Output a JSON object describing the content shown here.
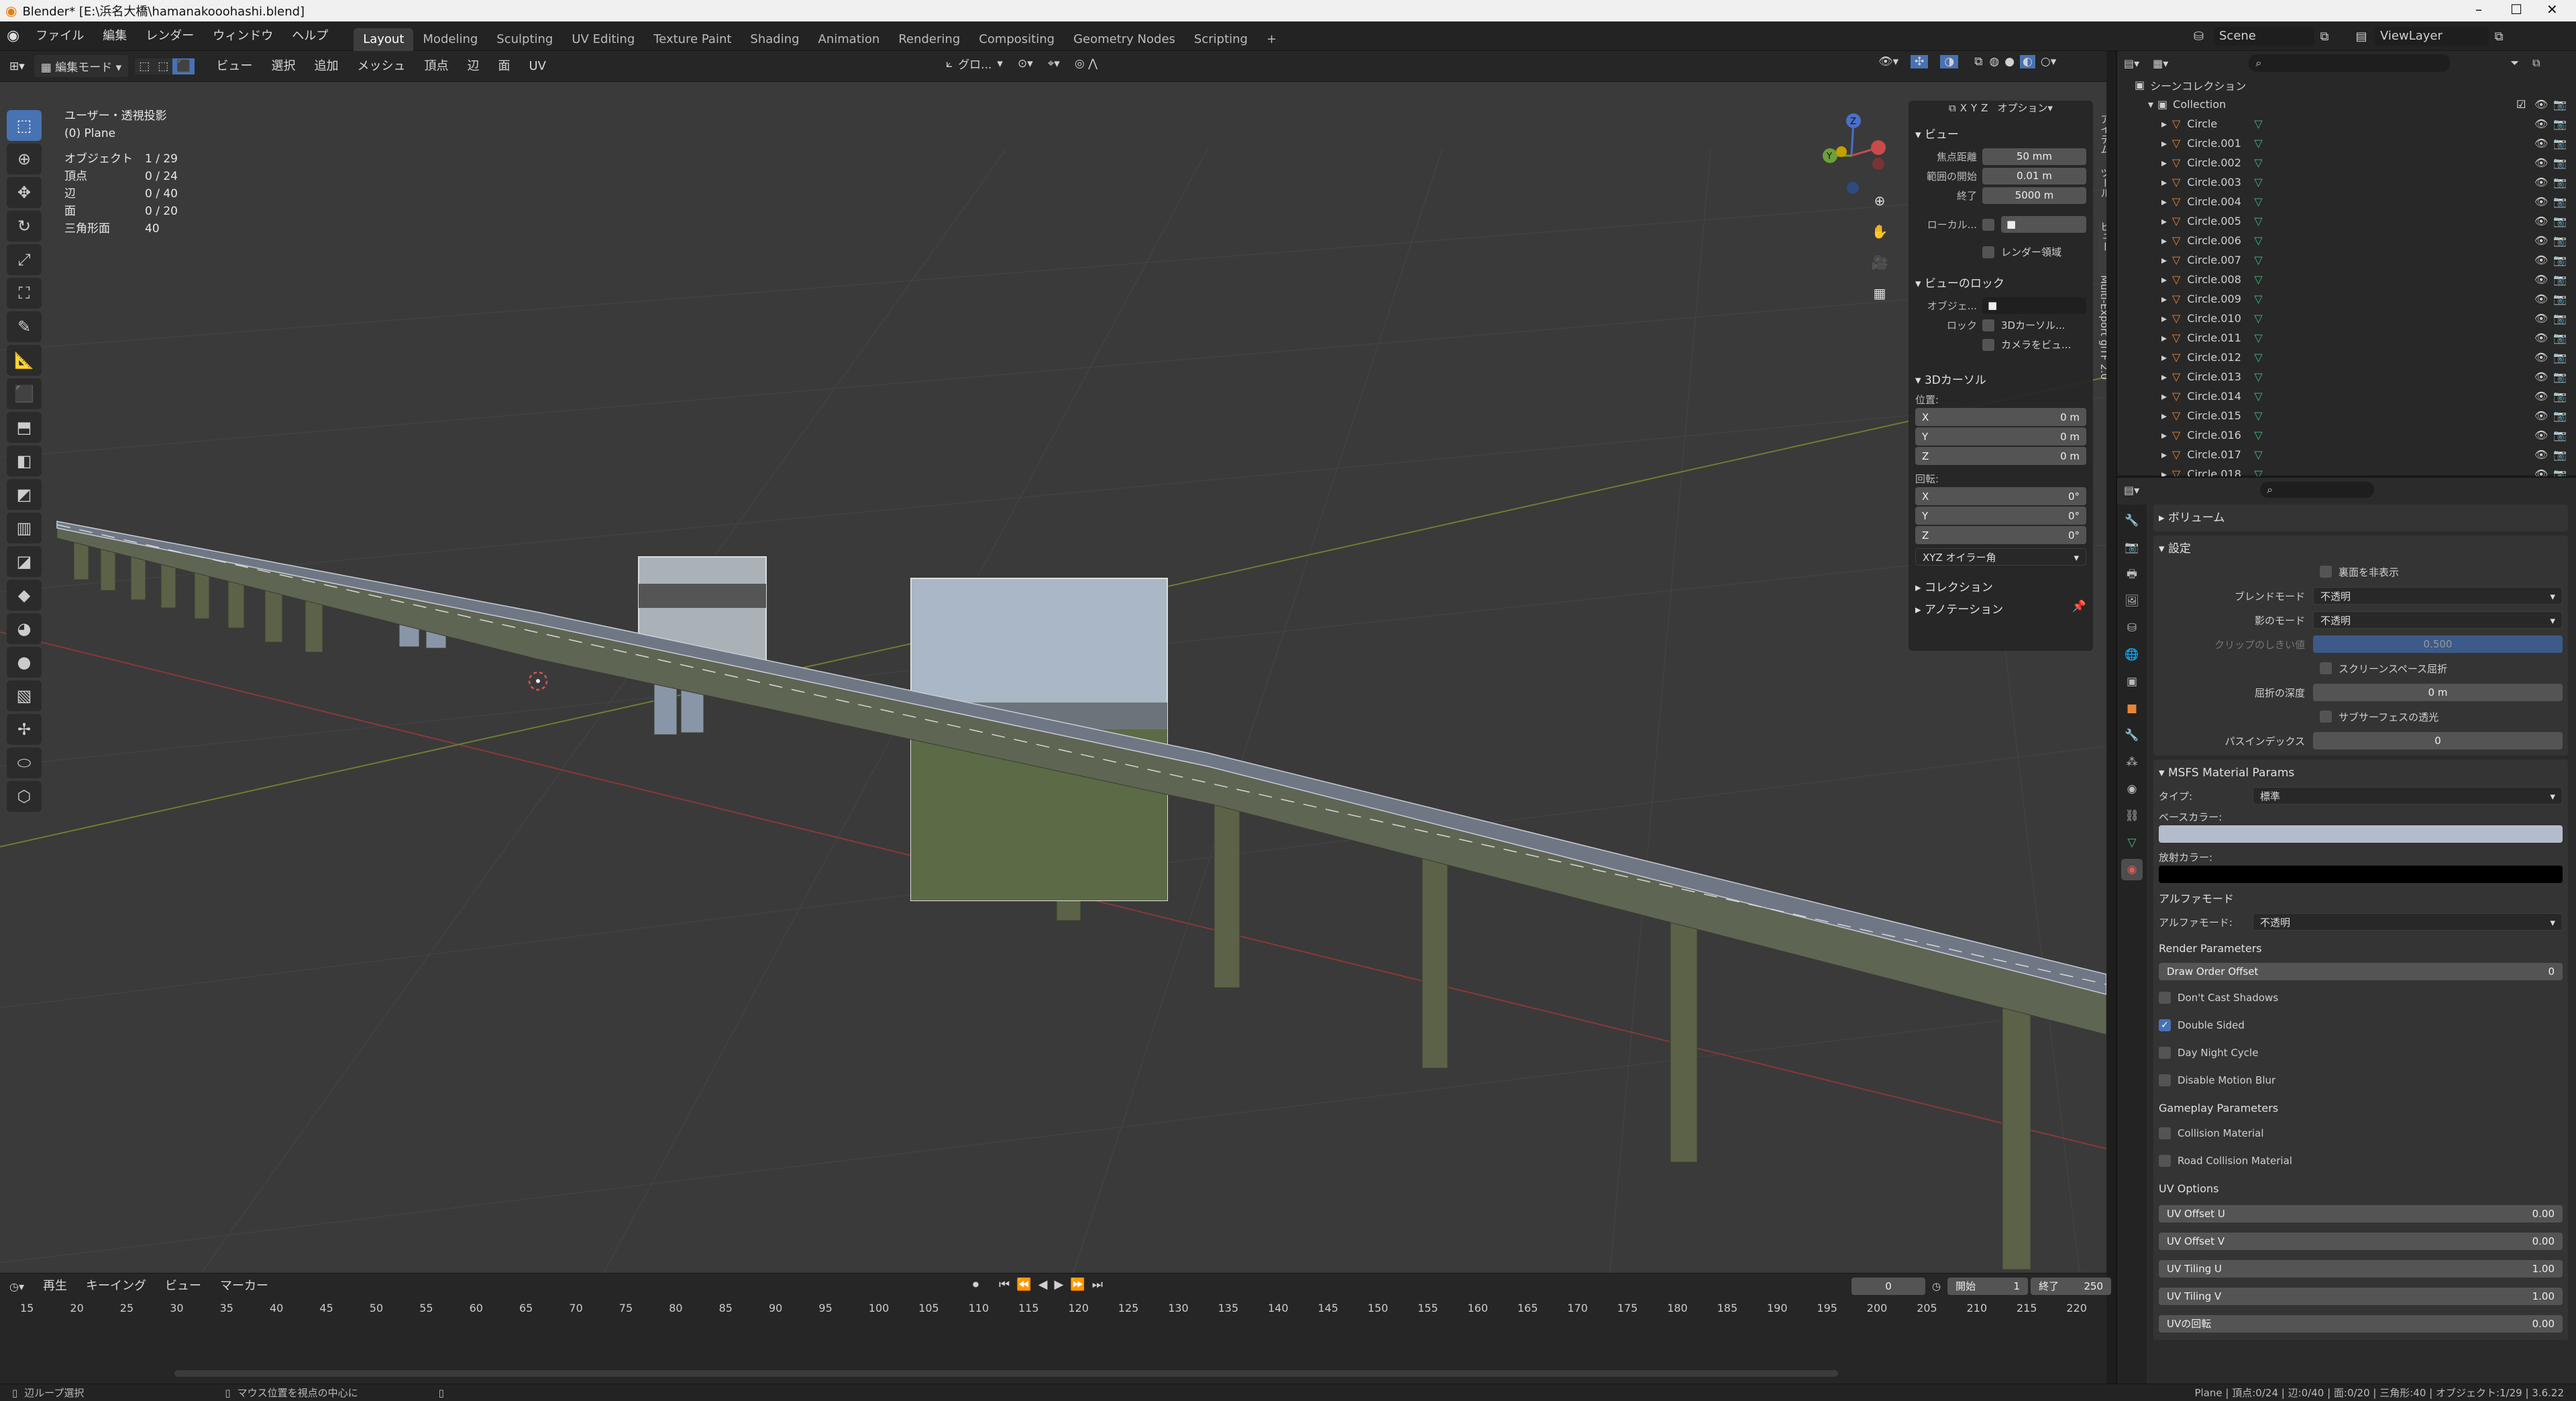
{
  "window": {
    "title": "Blender* [E:\\浜名大橋\\hamanakooohashi.blend]",
    "controls": [
      "–",
      "☐",
      "✕"
    ]
  },
  "menu": {
    "items": [
      "ファイル",
      "編集",
      "レンダー",
      "ウィンドウ",
      "ヘルプ"
    ]
  },
  "workspaces": [
    "Layout",
    "Modeling",
    "Sculpting",
    "UV Editing",
    "Texture Paint",
    "Shading",
    "Animation",
    "Rendering",
    "Compositing",
    "Geometry Nodes",
    "Scripting",
    "+"
  ],
  "scene": {
    "label": "Scene",
    "viewlayer": "ViewLayer"
  },
  "viewport_header": {
    "mode": "編集モード",
    "menus": [
      "ビュー",
      "選択",
      "追加",
      "メッシュ",
      "頂点",
      "辺",
      "面",
      "UV"
    ],
    "transform": "グロ...",
    "axes": [
      "X",
      "Y",
      "Z"
    ],
    "options": "オプション"
  },
  "viewport_info": {
    "view": "ユーザー・透視投影",
    "object": "(0) Plane",
    "stats": [
      {
        "label": "オブジェクト",
        "value": "1 / 29"
      },
      {
        "label": "頂点",
        "value": "0 / 24"
      },
      {
        "label": "辺",
        "value": "0 / 40"
      },
      {
        "label": "面",
        "value": "0 / 20"
      },
      {
        "label": "三角形面",
        "value": "40"
      }
    ]
  },
  "n_panel": {
    "view_title": "ビュー",
    "focal_label": "焦点距離",
    "focal_value": "50 mm",
    "clip_start_label": "範囲の開始",
    "clip_start_value": "0.01 m",
    "clip_end_label": "終了",
    "clip_end_value": "5000 m",
    "local_label": "ローカル...",
    "render_region": "レンダー領域",
    "view_lock_title": "ビューのロック",
    "lock_object_label": "オブジェ...",
    "lock_label": "ロック",
    "lock_cursor": "3Dカーソル...",
    "lock_camera": "カメラをビュ...",
    "cursor_title": "3Dカーソル",
    "location_label": "位置:",
    "loc": [
      {
        "axis": "X",
        "value": "0 m"
      },
      {
        "axis": "Y",
        "value": "0 m"
      },
      {
        "axis": "Z",
        "value": "0 m"
      }
    ],
    "rotation_label": "回転:",
    "rot": [
      {
        "axis": "X",
        "value": "0°"
      },
      {
        "axis": "Y",
        "value": "0°"
      },
      {
        "axis": "Z",
        "value": "0°"
      }
    ],
    "rot_mode": "XYZ オイラー角",
    "collection_title": "コレクション",
    "annotation_title": "アノテーション"
  },
  "vtabs": [
    "アイテム",
    "ツール",
    "ビュー",
    "Multi-Export glTF 2.0"
  ],
  "outliner": {
    "root": "シーンコレクション",
    "collection": "Collection",
    "objects": [
      "Circle",
      "Circle.001",
      "Circle.002",
      "Circle.003",
      "Circle.004",
      "Circle.005",
      "Circle.006",
      "Circle.007",
      "Circle.008",
      "Circle.009",
      "Circle.010",
      "Circle.011",
      "Circle.012",
      "Circle.013",
      "Circle.014",
      "Circle.015",
      "Circle.016",
      "Circle.017",
      "Circle.018"
    ]
  },
  "properties": {
    "volume": "ボリューム",
    "settings": "設定",
    "backface": "裏面を非表示",
    "blend_label": "ブレンドモード",
    "blend_value": "不透明",
    "shadow_label": "影のモード",
    "shadow_value": "不透明",
    "clip_label": "クリップのしきい値",
    "clip_value": "0.500",
    "ss_refraction": "スクリーンスペース屈折",
    "refr_depth_label": "屈折の深度",
    "refr_depth_value": "0 m",
    "sss": "サブサーフェスの透光",
    "pass_label": "パスインデックス",
    "pass_value": "0",
    "msfs_title": "MSFS Material Params",
    "type_label": "タイプ:",
    "type_value": "標準",
    "base_color_label": "ベースカラー:",
    "emissive_label": "放射カラー:",
    "alpha_title": "アルファモード",
    "alpha_label": "アルファモード:",
    "alpha_value": "不透明",
    "render_title": "Render Parameters",
    "draw_order_label": "Draw Order Offset",
    "draw_order_value": "0",
    "dont_cast": "Don't Cast Shadows",
    "double_sided": "Double Sided",
    "day_night": "Day Night Cycle",
    "disable_blur": "Disable Motion Blur",
    "gameplay_title": "Gameplay Parameters",
    "collision": "Collision Material",
    "road_collision": "Road Collision Material",
    "uv_title": "UV Options",
    "uv_fields": [
      {
        "label": "UV Offset U",
        "value": "0.00"
      },
      {
        "label": "UV Offset V",
        "value": "0.00"
      },
      {
        "label": "UV Tiling U",
        "value": "1.00"
      },
      {
        "label": "UV Tiling V",
        "value": "1.00"
      },
      {
        "label": "UVの回転",
        "value": "0.00"
      }
    ],
    "colors": {
      "base": "#b4bccb",
      "emissive": "#000000"
    }
  },
  "timeline": {
    "menus": [
      "再生",
      "キーイング",
      "ビュー",
      "マーカー"
    ],
    "current": "0",
    "start_label": "開始",
    "start": "1",
    "end_label": "終了",
    "end": "250",
    "ticks": [
      "15",
      "20",
      "25",
      "30",
      "35",
      "40",
      "45",
      "50",
      "55",
      "60",
      "65",
      "70",
      "75",
      "80",
      "85",
      "90",
      "95",
      "100",
      "105",
      "110",
      "115",
      "120",
      "125",
      "130",
      "135",
      "140",
      "145",
      "150",
      "155",
      "160",
      "165",
      "170",
      "175",
      "180",
      "185",
      "190",
      "195",
      "200",
      "205",
      "210",
      "215",
      "220"
    ]
  },
  "status": {
    "left": "辺ループ選択",
    "middle": "マウス位置を視点の中心に",
    "right": "Plane | 頂点:0/24 | 辺:0/40 | 面:0/20 | 三角形:40 | オブジェクト:1/29 | 3.6.22"
  }
}
